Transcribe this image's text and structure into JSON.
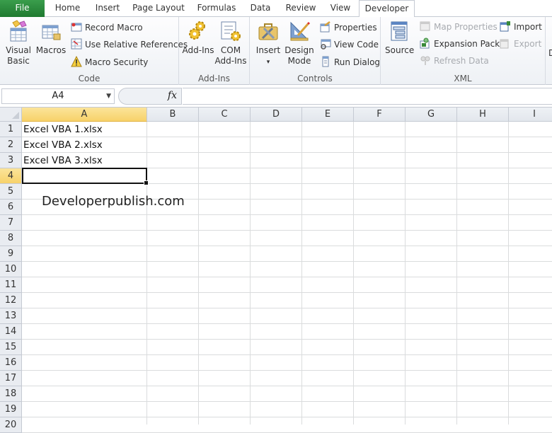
{
  "tabs": [
    {
      "label": "File",
      "active": false
    },
    {
      "label": "Home",
      "active": false
    },
    {
      "label": "Insert",
      "active": false
    },
    {
      "label": "Page Layout",
      "active": false
    },
    {
      "label": "Formulas",
      "active": false
    },
    {
      "label": "Data",
      "active": false
    },
    {
      "label": "Review",
      "active": false
    },
    {
      "label": "View",
      "active": false
    },
    {
      "label": "Developer",
      "active": true
    }
  ],
  "ribbon": {
    "code": {
      "label": "Code",
      "visual_basic": "Visual Basic",
      "visual_basic_l1": "Visual",
      "visual_basic_l2": "Basic",
      "macros": "Macros",
      "record_macro": "Record Macro",
      "use_relative": "Use Relative References",
      "macro_security": "Macro Security"
    },
    "addins": {
      "label": "Add-Ins",
      "add_ins": "Add-Ins",
      "com_l1": "COM",
      "com_l2": "Add-Ins"
    },
    "controls": {
      "label": "Controls",
      "insert": "Insert",
      "insert_arrow": "▾",
      "design_l1": "Design",
      "design_l2": "Mode",
      "properties": "Properties",
      "view_code": "View Code",
      "run_dialog": "Run Dialog"
    },
    "xml": {
      "label": "XML",
      "source": "Source",
      "map_properties": "Map Properties",
      "expansion_packs": "Expansion Packs",
      "refresh_data": "Refresh Data",
      "import": "Import",
      "export": "Export"
    },
    "next_group_partial": "D"
  },
  "formula_bar": {
    "name_box": "A4",
    "fx": "fx",
    "formula": ""
  },
  "sheet": {
    "columns": [
      "A",
      "B",
      "C",
      "D",
      "E",
      "F",
      "G",
      "H",
      "I"
    ],
    "selected_column": "A",
    "rows": [
      "1",
      "2",
      "3",
      "4",
      "5",
      "6",
      "7",
      "8",
      "9",
      "10",
      "11",
      "12",
      "13",
      "14",
      "15",
      "16",
      "17",
      "18",
      "19",
      "20"
    ],
    "selected_row": "4",
    "cells": {
      "A1": "Excel VBA 1.xlsx",
      "A2": "Excel VBA 2.xlsx",
      "A3": "Excel VBA 3.xlsx"
    },
    "active_cell": "A4"
  },
  "watermark": "Developerpublish.com",
  "colors": {
    "file_tab": "#2a8a3c",
    "selected_header": "#f7d26a",
    "gridline": "#dadcdd"
  }
}
